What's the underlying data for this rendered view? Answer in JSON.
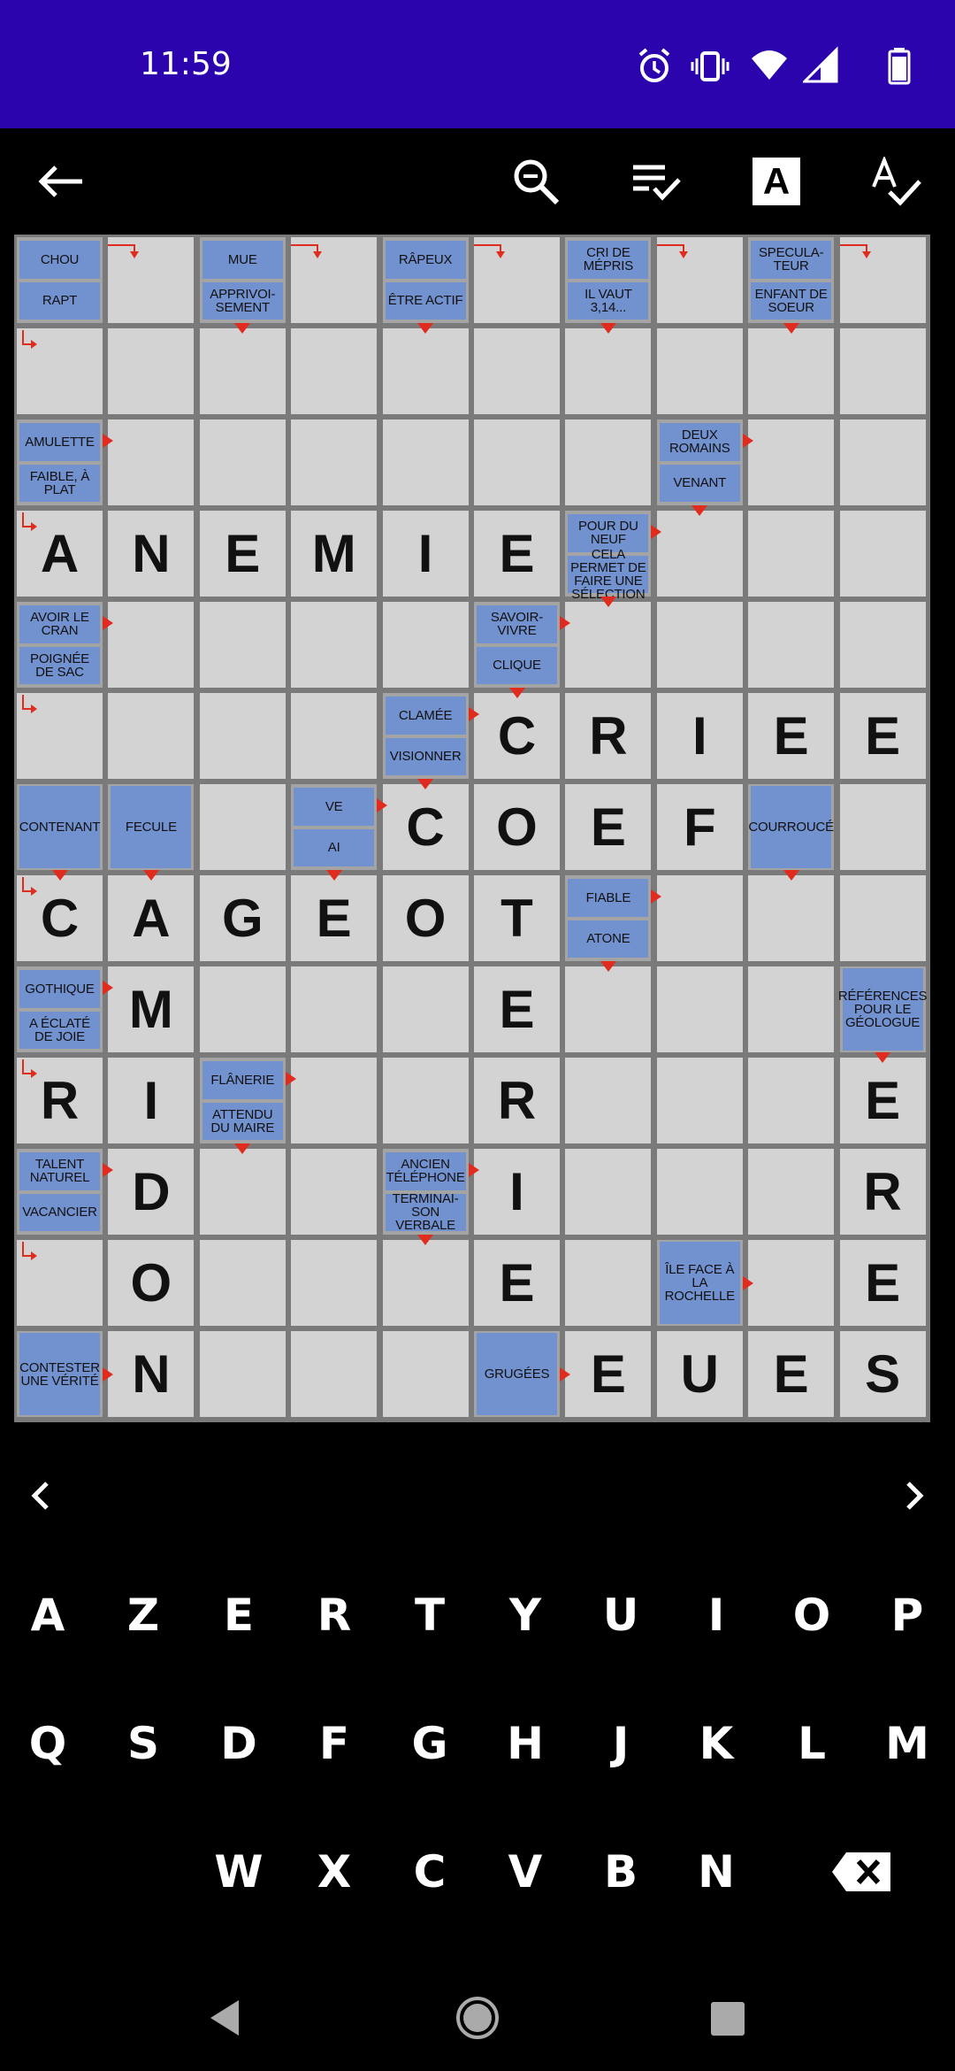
{
  "status_bar": {
    "time": "11:59",
    "icons": [
      "alarm-icon",
      "vibrate-icon",
      "wifi-icon",
      "signal-icon",
      "battery-icon"
    ]
  },
  "toolbar": {
    "icons": [
      "back-arrow-icon",
      "zoom-icon",
      "checklist-icon",
      "letter-a-icon",
      "spellcheck-icon"
    ],
    "letter_a": "A"
  },
  "colors": {
    "status_bar": "#2b04ad",
    "cell": "#d3d3d3",
    "clue": "#7291cf",
    "arrow": "#e02c1e",
    "grid_line": "#7a7a7a"
  },
  "grid": {
    "rows": [
      [
        "",
        "",
        "",
        "",
        "",
        "",
        "",
        "",
        "",
        ""
      ],
      [
        "",
        "",
        "",
        "",
        "",
        "",
        "",
        "",
        "",
        ""
      ],
      [
        "",
        "",
        "",
        "",
        "",
        "",
        "",
        "",
        "",
        ""
      ],
      [
        "A",
        "N",
        "E",
        "M",
        "I",
        "E",
        "",
        "",
        "",
        ""
      ],
      [
        "",
        "",
        "",
        "",
        "",
        "",
        "",
        "",
        "",
        ""
      ],
      [
        "",
        "",
        "",
        "",
        "",
        "C",
        "R",
        "I",
        "E",
        "E"
      ],
      [
        "",
        "",
        "",
        "",
        "C",
        "O",
        "E",
        "F",
        "",
        ""
      ],
      [
        "C",
        "A",
        "G",
        "E",
        "O",
        "T",
        "",
        "",
        "",
        ""
      ],
      [
        "",
        "M",
        "",
        "",
        "",
        "E",
        "",
        "",
        "",
        ""
      ],
      [
        "R",
        "I",
        "",
        "",
        "",
        "R",
        "",
        "",
        "",
        "E"
      ],
      [
        "",
        "D",
        "",
        "",
        "",
        "I",
        "",
        "",
        "",
        "R"
      ],
      [
        "",
        "O",
        "",
        "",
        "",
        "E",
        "",
        "",
        "",
        "E"
      ],
      [
        "",
        "N",
        "",
        "",
        "",
        "",
        "E",
        "U",
        "E",
        "S"
      ]
    ],
    "clues": {
      "r0c0a": "CHOU",
      "r0c0b": "RAPT",
      "r0c2a": "MUE",
      "r0c2b": "APPRIVOI-SEMENT",
      "r0c4a": "RÂPEUX",
      "r0c4b": "ÊTRE ACTIF",
      "r0c6a": "CRI DE MÉPRIS",
      "r0c6b": "IL VAUT 3,14...",
      "r0c8a": "SPECULA-TEUR",
      "r0c8b": "ENFANT DE SOEUR",
      "r2c0a": "AMULETTE",
      "r2c0b": "FAIBLE, À PLAT",
      "r2c7a": "DEUX ROMAINS",
      "r2c7b": "VENANT",
      "r3c6a": "POUR DU NEUF",
      "r3c6b": "CELA PERMET DE FAIRE UNE SÉLECTION",
      "r4c0a": "AVOIR LE CRAN",
      "r4c0b": "POIGNÉE DE SAC",
      "r4c5a": "SAVOIR-VIVRE",
      "r4c5b": "CLIQUE",
      "r5c4a": "CLAMÉE",
      "r5c4b": "VISIONNER",
      "r6c0": "CONTENANT",
      "r6c1": "FECULE",
      "r6c3a": "VE",
      "r6c3b": "AI",
      "r6c8": "COURROUCÉ",
      "r7c6a": "FIABLE",
      "r7c6b": "ATONE",
      "r8c0a": "GOTHIQUE",
      "r8c0b": "A ÉCLATÉ DE JOIE",
      "r8c9": "RÉFÉRENCES POUR LE GÉOLOGUE",
      "r9c2a": "FLÂNERIE",
      "r9c2b": "ATTENDU DU MAIRE",
      "r10c0a": "TALENT NATUREL",
      "r10c0b": "VACANCIER",
      "r10c4a": "ANCIEN TÉLÉPHONE",
      "r10c4b": "TERMINAI-SON VERBALE",
      "r11c7": "ÎLE FACE À LA ROCHELLE",
      "r12c0": "CONTESTER UNE VÉRITÉ",
      "r12c5": "GRUGÉES"
    }
  },
  "clue_nav": {
    "prev_icon": "chevron-left-icon",
    "next_icon": "chevron-right-icon"
  },
  "keyboard": {
    "row1": [
      "A",
      "Z",
      "E",
      "R",
      "T",
      "Y",
      "U",
      "I",
      "O",
      "P"
    ],
    "row2": [
      "Q",
      "S",
      "D",
      "F",
      "G",
      "H",
      "J",
      "K",
      "L",
      "M"
    ],
    "row3": [
      "W",
      "X",
      "C",
      "V",
      "B",
      "N"
    ],
    "backspace_icon": "backspace-icon"
  },
  "system_nav": [
    "back-triangle-icon",
    "home-circle-icon",
    "recents-square-icon"
  ]
}
